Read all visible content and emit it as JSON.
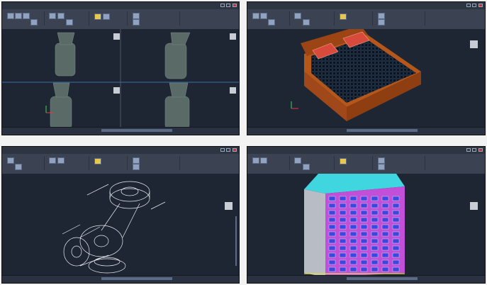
{
  "panels": [
    {
      "id": "top-left",
      "title": "",
      "content": "four-viewport-valve"
    },
    {
      "id": "top-right",
      "title": "",
      "content": "bed-model"
    },
    {
      "id": "bottom-left",
      "title": "",
      "content": "wireframe-flange-pipe"
    },
    {
      "id": "bottom-right",
      "title": "",
      "content": "building-model"
    }
  ],
  "icons": {
    "viewcube": "viewcube-icon",
    "ucs": "ucs-axis-icon",
    "minimize": "minimize-icon",
    "maximize": "maximize-icon",
    "close": "close-icon"
  },
  "colors": {
    "viewport_bg": "#1f2633",
    "ribbon_bg": "#3b4352",
    "bed_frame": "#b5561b",
    "pillow": "#d84a3c",
    "mattress_grid": "#0a1420",
    "roof": "#3fd6e0",
    "facade_magenta": "#c24fd8",
    "facade_blue": "#3a48e0",
    "wall_gray": "#b8bcc4",
    "wire": "#e9edf3"
  }
}
